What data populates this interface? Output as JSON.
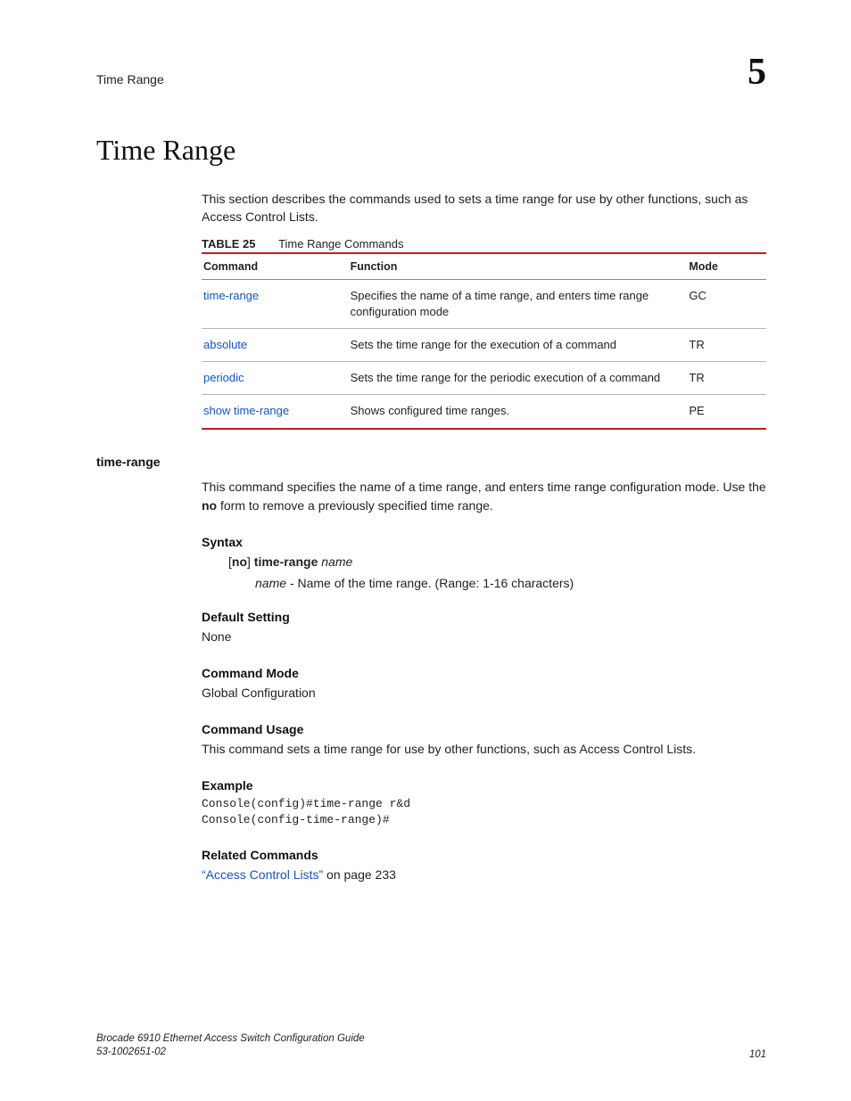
{
  "header": {
    "running_title": "Time Range",
    "chapter_number": "5"
  },
  "section": {
    "title": "Time Range",
    "intro": "This section describes the commands used to sets a time range for use by other functions, such as Access Control Lists."
  },
  "table": {
    "caption_label": "TABLE 25",
    "caption_text": "Time Range Commands",
    "headers": {
      "c0": "Command",
      "c1": "Function",
      "c2": "Mode"
    },
    "rows": [
      {
        "cmd": "time-range",
        "func": "Specifies the name of a time range, and enters time range configuration mode",
        "mode": "GC"
      },
      {
        "cmd": "absolute",
        "func": "Sets the time range for the execution of a command",
        "mode": "TR"
      },
      {
        "cmd": "periodic",
        "func": "Sets the time range for the periodic execution of a command",
        "mode": "TR"
      },
      {
        "cmd": "show time-range",
        "func": "Shows configured time ranges.",
        "mode": "PE"
      }
    ]
  },
  "cmd": {
    "name": "time-range",
    "desc_pre": "This command specifies the name of a time range, and enters time range configuration mode. Use the ",
    "desc_bold": "no",
    "desc_post": " form to remove a previously specified time range.",
    "syntax_head": "Syntax",
    "syntax_open": "[",
    "syntax_no": "no",
    "syntax_close": "] ",
    "syntax_kw": "time-range",
    "syntax_arg": "name",
    "arg_name": "name",
    "arg_desc": " - Name of the time range. (Range: 1-16 characters)",
    "default_head": "Default Setting",
    "default_val": "None",
    "mode_head": "Command Mode",
    "mode_val": "Global Configuration",
    "usage_head": "Command Usage",
    "usage_val": "This command sets a time range for use by other functions, such as Access Control Lists.",
    "example_head": "Example",
    "example_code": "Console(config)#time-range r&d\nConsole(config-time-range)#",
    "related_head": "Related Commands",
    "related_link": "“Access Control Lists”",
    "related_tail": " on page 233"
  },
  "footer": {
    "book": "Brocade 6910 Ethernet Access Switch Configuration Guide",
    "partno": "53-1002651-02",
    "page": "101"
  }
}
